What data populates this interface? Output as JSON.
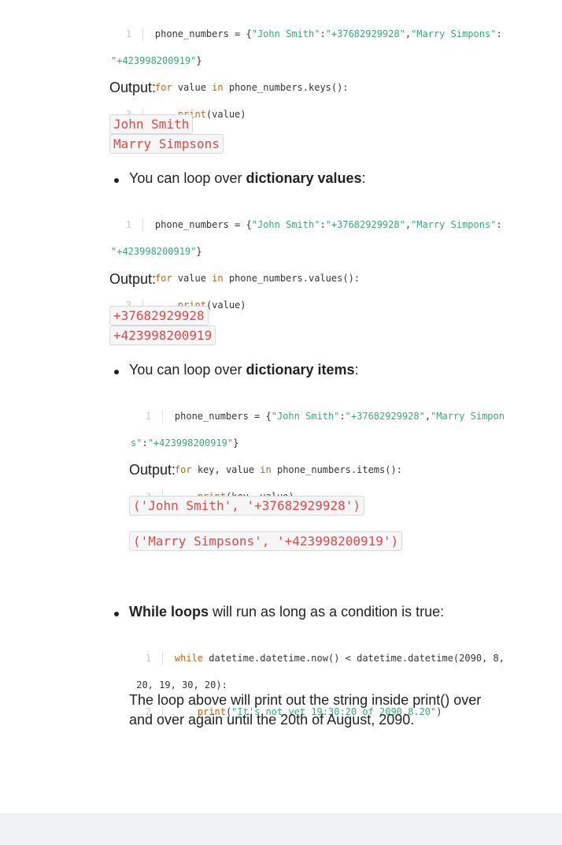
{
  "code1": {
    "line1a": "phone_numbers = {",
    "s1": "\"John Smith\"",
    "colon": ":",
    "s2": "\"+37682929928\"",
    "comma": ",",
    "s3": "\"Marry Simpons\"",
    "colon2": ":",
    "s4": "\"+423998200919\"",
    "close": "}",
    "kw_for": "for",
    "line2a": " value ",
    "kw_in": "in",
    "line2b": " phone_numbers.keys():",
    "fn_print": "print",
    "line3b": "(value)"
  },
  "output_label": "Output:",
  "out1": [
    "John Smith",
    "Marry Simpsons"
  ],
  "bullet2_pre": "You can loop over ",
  "bullet2_bold": "dictionary values",
  "bullet2_post": ":",
  "code2": {
    "line2b": " phone_numbers.values():"
  },
  "out2": [
    "+37682929928",
    "+423998200919"
  ],
  "bullet3_pre": "You can loop over ",
  "bullet3_bold": "dictionary items",
  "bullet3_post": ":",
  "code3": {
    "s3a": "\"Marry Simpon",
    "s3b": "s\"",
    "line2a": " key, value ",
    "line2b": " phone_numbers.items():",
    "line3b": "(key, value)"
  },
  "out3": [
    "('John Smith', '+37682929928')",
    "('Marry Simpsons', '+423998200919')"
  ],
  "bullet4_bold": "While loops",
  "bullet4_post": " will run as long as a condition is true:",
  "code4": {
    "kw_while": "while",
    "line1a": " datetime.datetime.now() < datetime.datetime(2090, 8,",
    "line1b": "20, 19, 30, 20):",
    "s": "\"It's not yet 19:30:20 of 2090.8.20\"",
    "close": ")"
  },
  "para": "The loop above will print out the string inside print() over and over again until the 20th of August, 2090."
}
